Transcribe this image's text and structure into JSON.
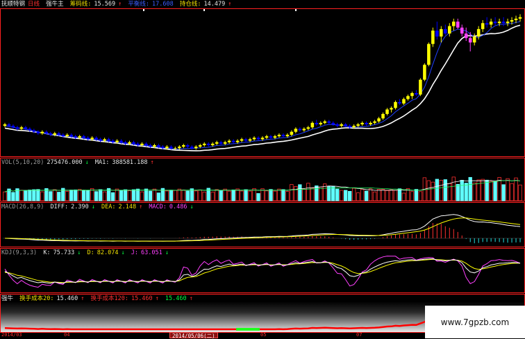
{
  "header": {
    "stock": "抚顺特钢",
    "period": "日线",
    "indicator_name": "强牛主",
    "chouma_label": "筹码线:",
    "chouma_value": "15.569",
    "chouma_arrow": "↑",
    "ping_label": "平衡线:",
    "ping_value": "17.608",
    "chicang_label": "持仓线:",
    "chicang_value": "14.479",
    "chicang_arrow": "↑"
  },
  "vol_header": {
    "name": "VOL(5,10,20)",
    "value": "275476.000",
    "value_arrow": "↓",
    "ma1_label": "MA1:",
    "ma1_value": "388581.188",
    "ma1_arrow": "↑"
  },
  "macd_header": {
    "name": "MACD(26,8,9)",
    "diff_label": "DIFF:",
    "diff_value": "2.390",
    "diff_arrow": "↓",
    "dea_label": "DEA:",
    "dea_value": "2.148",
    "dea_arrow": "↑",
    "macd_label": "MACD:",
    "macd_value": "0.486",
    "macd_arrow": "↓"
  },
  "kdj_header": {
    "name": "KDJ(9,3,3)",
    "k_label": "K:",
    "k_value": "75.733",
    "k_arrow": "↓",
    "d_label": "D:",
    "d_value": "82.074",
    "d_arrow": "↓",
    "j_label": "J:",
    "j_value": "63.051",
    "j_arrow": "↓"
  },
  "bottom_header": {
    "name": "强牛",
    "c20_label": "换手成本20:",
    "c20_value": "15.460",
    "c20_arrow": "↑",
    "c120_label": "换手成本120:",
    "c120_value": "15.460",
    "c120_arrow": "↑",
    "c_value": "15.460",
    "c_arrow": "↑"
  },
  "date_bar": {
    "left_label": "2014/03",
    "ticks": [
      "04",
      "2014/05/06(二)",
      "05",
      "07"
    ],
    "selected": "2014/05/06(二)"
  },
  "watermark": "www.7gpzb.com",
  "colors": {
    "background": "#000000",
    "up_candle": "#ffff00",
    "down_candle": "#0000ff",
    "ma_line": "#ffffff",
    "divider": "#ff2020",
    "vol_up": "#ff3030",
    "vol_down": "#60ffff",
    "kdj_k": "#ffffff",
    "kdj_d": "#ffff00",
    "kdj_j": "#ff40ff",
    "cost_line": "#ff0000"
  },
  "chart_data": [
    {
      "type": "candlestick",
      "panel": "main",
      "n_bars": 125,
      "ohlc": [
        [
          9.2,
          9.4,
          9.1,
          9.3
        ],
        [
          9.3,
          9.4,
          9.1,
          9.2
        ],
        [
          9.2,
          9.3,
          9.0,
          9.1
        ],
        [
          9.1,
          9.2,
          8.9,
          9.0
        ],
        [
          9.0,
          9.2,
          8.9,
          9.1
        ],
        [
          9.1,
          9.2,
          8.9,
          9.0
        ],
        [
          9.0,
          9.1,
          8.8,
          8.9
        ],
        [
          8.9,
          9.0,
          8.7,
          8.8
        ],
        [
          8.8,
          8.9,
          8.6,
          8.7
        ],
        [
          8.7,
          8.9,
          8.6,
          8.8
        ],
        [
          8.8,
          8.9,
          8.6,
          8.7
        ],
        [
          8.7,
          8.8,
          8.5,
          8.6
        ],
        [
          8.6,
          8.8,
          8.5,
          8.7
        ],
        [
          8.7,
          8.8,
          8.5,
          8.6
        ],
        [
          8.6,
          8.7,
          8.4,
          8.5
        ],
        [
          8.5,
          8.7,
          8.4,
          8.6
        ],
        [
          8.6,
          8.7,
          8.4,
          8.5
        ],
        [
          8.5,
          8.6,
          8.3,
          8.4
        ],
        [
          8.4,
          8.6,
          8.3,
          8.5
        ],
        [
          8.5,
          8.6,
          8.3,
          8.4
        ],
        [
          8.4,
          8.5,
          8.2,
          8.3
        ],
        [
          8.3,
          8.5,
          8.2,
          8.4
        ],
        [
          8.4,
          8.5,
          8.2,
          8.3
        ],
        [
          8.3,
          8.4,
          8.1,
          8.2
        ],
        [
          8.2,
          8.4,
          8.1,
          8.3
        ],
        [
          8.3,
          8.4,
          8.1,
          8.2
        ],
        [
          8.2,
          8.3,
          8.0,
          8.1
        ],
        [
          8.1,
          8.3,
          8.0,
          8.2
        ],
        [
          8.2,
          8.3,
          8.0,
          8.1
        ],
        [
          8.1,
          8.2,
          7.9,
          8.0
        ],
        [
          8.0,
          8.2,
          7.9,
          8.1
        ],
        [
          8.1,
          8.2,
          7.9,
          8.0
        ],
        [
          8.0,
          8.1,
          7.8,
          7.9
        ],
        [
          7.9,
          8.1,
          7.8,
          8.0
        ],
        [
          8.0,
          8.1,
          7.8,
          7.9
        ],
        [
          7.9,
          8.0,
          7.7,
          7.8
        ],
        [
          7.8,
          8.0,
          7.7,
          7.9
        ],
        [
          7.9,
          8.0,
          7.7,
          7.8
        ],
        [
          7.8,
          7.9,
          7.6,
          7.7
        ],
        [
          7.7,
          7.9,
          7.6,
          7.8
        ],
        [
          7.8,
          7.9,
          7.6,
          7.7
        ],
        [
          7.7,
          7.8,
          7.6,
          7.7
        ],
        [
          7.7,
          7.9,
          7.6,
          7.8
        ],
        [
          7.8,
          8.0,
          7.7,
          7.9
        ],
        [
          7.9,
          8.0,
          7.7,
          7.8
        ],
        [
          7.8,
          7.9,
          7.6,
          7.7
        ],
        [
          7.7,
          7.9,
          7.6,
          7.8
        ],
        [
          7.8,
          8.0,
          7.7,
          7.9
        ],
        [
          7.9,
          8.1,
          7.8,
          8.0
        ],
        [
          8.0,
          8.1,
          7.8,
          7.9
        ],
        [
          7.9,
          8.1,
          7.8,
          8.0
        ],
        [
          8.0,
          8.2,
          7.9,
          8.1
        ],
        [
          8.1,
          8.2,
          7.9,
          8.0
        ],
        [
          8.0,
          8.2,
          7.9,
          8.1
        ],
        [
          8.1,
          8.3,
          8.0,
          8.2
        ],
        [
          8.2,
          8.3,
          8.0,
          8.1
        ],
        [
          8.1,
          8.3,
          8.0,
          8.2
        ],
        [
          8.2,
          8.4,
          8.1,
          8.3
        ],
        [
          8.3,
          8.4,
          8.1,
          8.2
        ],
        [
          8.2,
          8.4,
          8.1,
          8.3
        ],
        [
          8.3,
          8.5,
          8.2,
          8.4
        ],
        [
          8.4,
          8.5,
          8.2,
          8.3
        ],
        [
          8.3,
          8.5,
          8.2,
          8.4
        ],
        [
          8.4,
          8.6,
          8.3,
          8.5
        ],
        [
          8.5,
          8.6,
          8.3,
          8.4
        ],
        [
          8.4,
          8.6,
          8.3,
          8.5
        ],
        [
          8.5,
          8.7,
          8.4,
          8.6
        ],
        [
          8.6,
          8.7,
          8.4,
          8.5
        ],
        [
          8.5,
          8.7,
          8.4,
          8.6
        ],
        [
          8.6,
          8.9,
          8.5,
          8.8
        ],
        [
          8.8,
          9.1,
          8.7,
          9.0
        ],
        [
          9.0,
          9.1,
          8.8,
          8.9
        ],
        [
          8.9,
          9.1,
          8.8,
          9.0
        ],
        [
          9.0,
          9.2,
          8.9,
          9.1
        ],
        [
          9.1,
          9.5,
          9.0,
          9.4
        ],
        [
          9.4,
          9.6,
          9.2,
          9.3
        ],
        [
          9.3,
          9.5,
          9.2,
          9.4
        ],
        [
          9.4,
          9.6,
          9.3,
          9.5
        ],
        [
          9.5,
          9.6,
          9.3,
          9.4
        ],
        [
          9.4,
          9.5,
          9.2,
          9.3
        ],
        [
          9.3,
          9.4,
          9.1,
          9.2
        ],
        [
          9.2,
          9.4,
          9.1,
          9.3
        ],
        [
          9.3,
          9.4,
          9.1,
          9.2
        ],
        [
          9.2,
          9.3,
          9.0,
          9.1
        ],
        [
          9.1,
          9.3,
          9.0,
          9.2
        ],
        [
          9.2,
          9.4,
          9.1,
          9.3
        ],
        [
          9.3,
          9.5,
          9.2,
          9.4
        ],
        [
          9.4,
          9.5,
          9.2,
          9.3
        ],
        [
          9.3,
          9.5,
          9.2,
          9.4
        ],
        [
          9.4,
          9.6,
          9.3,
          9.5
        ],
        [
          9.5,
          9.8,
          9.4,
          9.7
        ],
        [
          9.7,
          10.1,
          9.6,
          10.0
        ],
        [
          10.0,
          10.4,
          9.9,
          10.3
        ],
        [
          10.3,
          10.5,
          10.1,
          10.4
        ],
        [
          10.4,
          10.9,
          10.3,
          10.8
        ],
        [
          10.8,
          11.0,
          10.6,
          10.7
        ],
        [
          10.7,
          11.1,
          10.6,
          11.0
        ],
        [
          11.0,
          11.3,
          10.9,
          11.2
        ],
        [
          11.2,
          11.5,
          11.0,
          11.4
        ],
        [
          11.4,
          11.6,
          11.2,
          11.3
        ],
        [
          11.3,
          12.4,
          11.2,
          12.3
        ],
        [
          12.3,
          13.4,
          12.2,
          13.3
        ],
        [
          13.3,
          14.8,
          13.2,
          14.7
        ],
        [
          14.7,
          15.8,
          14.5,
          15.6
        ],
        [
          15.6,
          16.2,
          15.0,
          15.2
        ],
        [
          15.2,
          15.9,
          14.8,
          15.7
        ],
        [
          15.7,
          16.0,
          15.3,
          15.4
        ],
        [
          15.4,
          16.1,
          15.2,
          15.9
        ],
        [
          15.9,
          16.4,
          15.6,
          16.2
        ],
        [
          16.2,
          16.4,
          15.7,
          15.8
        ],
        [
          15.8,
          16.0,
          15.2,
          15.4
        ],
        [
          15.4,
          15.8,
          14.9,
          15.1
        ],
        [
          15.1,
          15.5,
          14.2,
          14.8
        ],
        [
          14.8,
          15.4,
          14.6,
          15.2
        ],
        [
          15.2,
          15.9,
          15.0,
          15.7
        ],
        [
          15.7,
          16.3,
          15.5,
          16.1
        ],
        [
          16.1,
          16.5,
          15.8,
          16.0
        ],
        [
          16.0,
          16.4,
          15.8,
          16.2
        ],
        [
          16.2,
          16.5,
          15.9,
          16.1
        ],
        [
          16.1,
          16.4,
          15.9,
          16.2
        ],
        [
          16.2,
          16.5,
          15.9,
          16.1
        ],
        [
          16.1,
          16.4,
          15.9,
          16.2
        ],
        [
          16.2,
          16.5,
          16.0,
          16.3
        ],
        [
          16.3,
          16.6,
          16.1,
          16.4
        ],
        [
          16.4,
          16.7,
          16.2,
          16.5
        ]
      ],
      "ylim": [
        7.2,
        17.0
      ]
    },
    {
      "type": "bar",
      "panel": "volume",
      "n_bars": 125,
      "ylim": [
        0,
        1200000
      ]
    },
    {
      "type": "bar+line",
      "panel": "macd",
      "series": [
        {
          "name": "DIFF",
          "value": 2.39
        },
        {
          "name": "DEA",
          "value": 2.148
        },
        {
          "name": "MACD",
          "value": 0.486
        }
      ]
    },
    {
      "type": "line",
      "panel": "kdj",
      "ylim": [
        -10,
        110
      ],
      "series": [
        {
          "name": "K",
          "value": 75.733
        },
        {
          "name": "D",
          "value": 82.074
        },
        {
          "name": "J",
          "value": 63.051
        }
      ]
    },
    {
      "type": "area",
      "panel": "cost",
      "series": [
        {
          "name": "换手成本20",
          "value": 15.46
        },
        {
          "name": "换手成本120",
          "value": 15.46
        }
      ]
    }
  ]
}
